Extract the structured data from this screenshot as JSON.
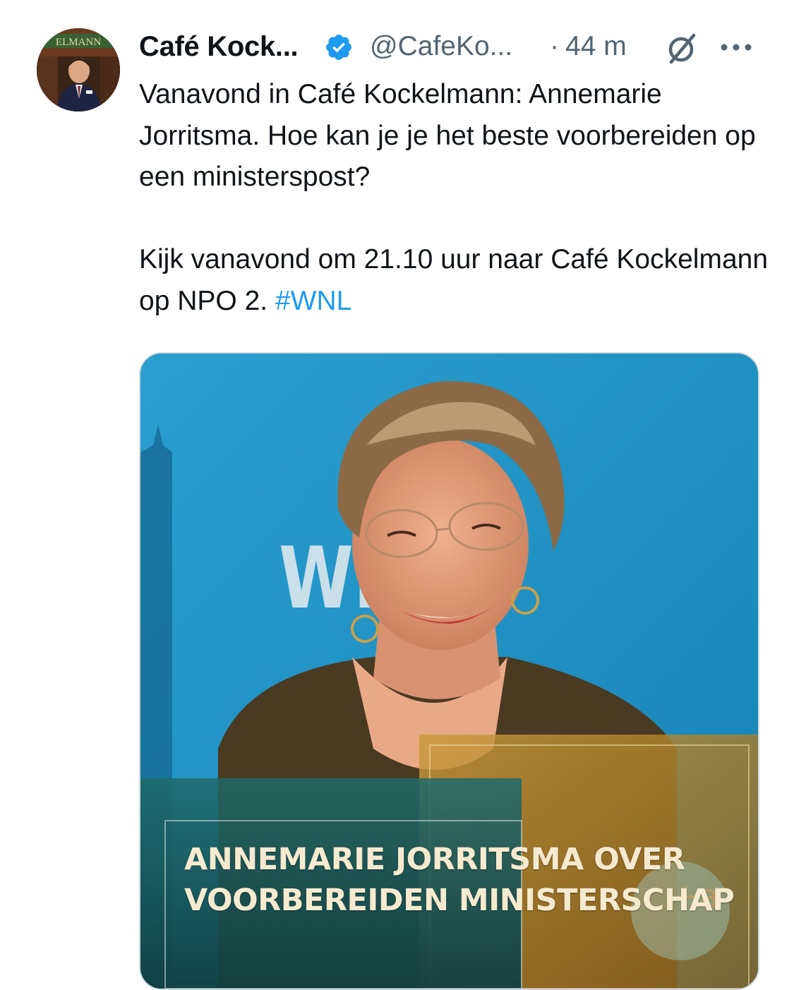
{
  "author": {
    "display_name": "Café Kock...",
    "handle": "@CafeKo...",
    "separator": "·",
    "time": "44 m",
    "avatar_icon": "profile-photo",
    "avatar_label": "ELMANN"
  },
  "tweet": {
    "line1": "Vanavond in Café Kockelmann: Annemarie Jorritsma. Hoe kan je je het beste voorbereiden op een ministerspost?",
    "line2_text": "Kijk vanavond om 21.10 uur naar Café Kockelmann op NPO 2. ",
    "hashtag": "#WNL"
  },
  "media": {
    "caption_line1": "ANNEMARIE JORRITSMA OVER",
    "caption_line2": "VOORBEREIDEN MINISTERSCHAP",
    "background_text": "WE SI"
  },
  "colors": {
    "hashtag": "#1d9bf0",
    "verified": "#1d9bf0",
    "secondary_text": "#536471"
  }
}
